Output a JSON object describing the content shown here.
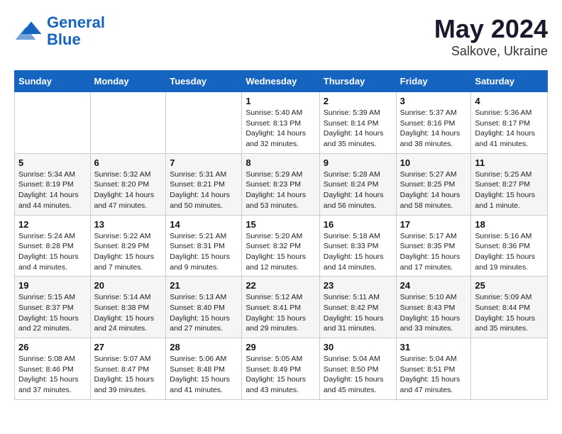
{
  "logo": {
    "line1": "General",
    "line2": "Blue"
  },
  "title": "May 2024",
  "location": "Salkove, Ukraine",
  "days_header": [
    "Sunday",
    "Monday",
    "Tuesday",
    "Wednesday",
    "Thursday",
    "Friday",
    "Saturday"
  ],
  "weeks": [
    [
      {
        "day": "",
        "info": ""
      },
      {
        "day": "",
        "info": ""
      },
      {
        "day": "",
        "info": ""
      },
      {
        "day": "1",
        "info": "Sunrise: 5:40 AM\nSunset: 8:13 PM\nDaylight: 14 hours\nand 32 minutes."
      },
      {
        "day": "2",
        "info": "Sunrise: 5:39 AM\nSunset: 8:14 PM\nDaylight: 14 hours\nand 35 minutes."
      },
      {
        "day": "3",
        "info": "Sunrise: 5:37 AM\nSunset: 8:16 PM\nDaylight: 14 hours\nand 38 minutes."
      },
      {
        "day": "4",
        "info": "Sunrise: 5:36 AM\nSunset: 8:17 PM\nDaylight: 14 hours\nand 41 minutes."
      }
    ],
    [
      {
        "day": "5",
        "info": "Sunrise: 5:34 AM\nSunset: 8:19 PM\nDaylight: 14 hours\nand 44 minutes."
      },
      {
        "day": "6",
        "info": "Sunrise: 5:32 AM\nSunset: 8:20 PM\nDaylight: 14 hours\nand 47 minutes."
      },
      {
        "day": "7",
        "info": "Sunrise: 5:31 AM\nSunset: 8:21 PM\nDaylight: 14 hours\nand 50 minutes."
      },
      {
        "day": "8",
        "info": "Sunrise: 5:29 AM\nSunset: 8:23 PM\nDaylight: 14 hours\nand 53 minutes."
      },
      {
        "day": "9",
        "info": "Sunrise: 5:28 AM\nSunset: 8:24 PM\nDaylight: 14 hours\nand 56 minutes."
      },
      {
        "day": "10",
        "info": "Sunrise: 5:27 AM\nSunset: 8:25 PM\nDaylight: 14 hours\nand 58 minutes."
      },
      {
        "day": "11",
        "info": "Sunrise: 5:25 AM\nSunset: 8:27 PM\nDaylight: 15 hours\nand 1 minute."
      }
    ],
    [
      {
        "day": "12",
        "info": "Sunrise: 5:24 AM\nSunset: 8:28 PM\nDaylight: 15 hours\nand 4 minutes."
      },
      {
        "day": "13",
        "info": "Sunrise: 5:22 AM\nSunset: 8:29 PM\nDaylight: 15 hours\nand 7 minutes."
      },
      {
        "day": "14",
        "info": "Sunrise: 5:21 AM\nSunset: 8:31 PM\nDaylight: 15 hours\nand 9 minutes."
      },
      {
        "day": "15",
        "info": "Sunrise: 5:20 AM\nSunset: 8:32 PM\nDaylight: 15 hours\nand 12 minutes."
      },
      {
        "day": "16",
        "info": "Sunrise: 5:18 AM\nSunset: 8:33 PM\nDaylight: 15 hours\nand 14 minutes."
      },
      {
        "day": "17",
        "info": "Sunrise: 5:17 AM\nSunset: 8:35 PM\nDaylight: 15 hours\nand 17 minutes."
      },
      {
        "day": "18",
        "info": "Sunrise: 5:16 AM\nSunset: 8:36 PM\nDaylight: 15 hours\nand 19 minutes."
      }
    ],
    [
      {
        "day": "19",
        "info": "Sunrise: 5:15 AM\nSunset: 8:37 PM\nDaylight: 15 hours\nand 22 minutes."
      },
      {
        "day": "20",
        "info": "Sunrise: 5:14 AM\nSunset: 8:38 PM\nDaylight: 15 hours\nand 24 minutes."
      },
      {
        "day": "21",
        "info": "Sunrise: 5:13 AM\nSunset: 8:40 PM\nDaylight: 15 hours\nand 27 minutes."
      },
      {
        "day": "22",
        "info": "Sunrise: 5:12 AM\nSunset: 8:41 PM\nDaylight: 15 hours\nand 29 minutes."
      },
      {
        "day": "23",
        "info": "Sunrise: 5:11 AM\nSunset: 8:42 PM\nDaylight: 15 hours\nand 31 minutes."
      },
      {
        "day": "24",
        "info": "Sunrise: 5:10 AM\nSunset: 8:43 PM\nDaylight: 15 hours\nand 33 minutes."
      },
      {
        "day": "25",
        "info": "Sunrise: 5:09 AM\nSunset: 8:44 PM\nDaylight: 15 hours\nand 35 minutes."
      }
    ],
    [
      {
        "day": "26",
        "info": "Sunrise: 5:08 AM\nSunset: 8:46 PM\nDaylight: 15 hours\nand 37 minutes."
      },
      {
        "day": "27",
        "info": "Sunrise: 5:07 AM\nSunset: 8:47 PM\nDaylight: 15 hours\nand 39 minutes."
      },
      {
        "day": "28",
        "info": "Sunrise: 5:06 AM\nSunset: 8:48 PM\nDaylight: 15 hours\nand 41 minutes."
      },
      {
        "day": "29",
        "info": "Sunrise: 5:05 AM\nSunset: 8:49 PM\nDaylight: 15 hours\nand 43 minutes."
      },
      {
        "day": "30",
        "info": "Sunrise: 5:04 AM\nSunset: 8:50 PM\nDaylight: 15 hours\nand 45 minutes."
      },
      {
        "day": "31",
        "info": "Sunrise: 5:04 AM\nSunset: 8:51 PM\nDaylight: 15 hours\nand 47 minutes."
      },
      {
        "day": "",
        "info": ""
      }
    ]
  ]
}
